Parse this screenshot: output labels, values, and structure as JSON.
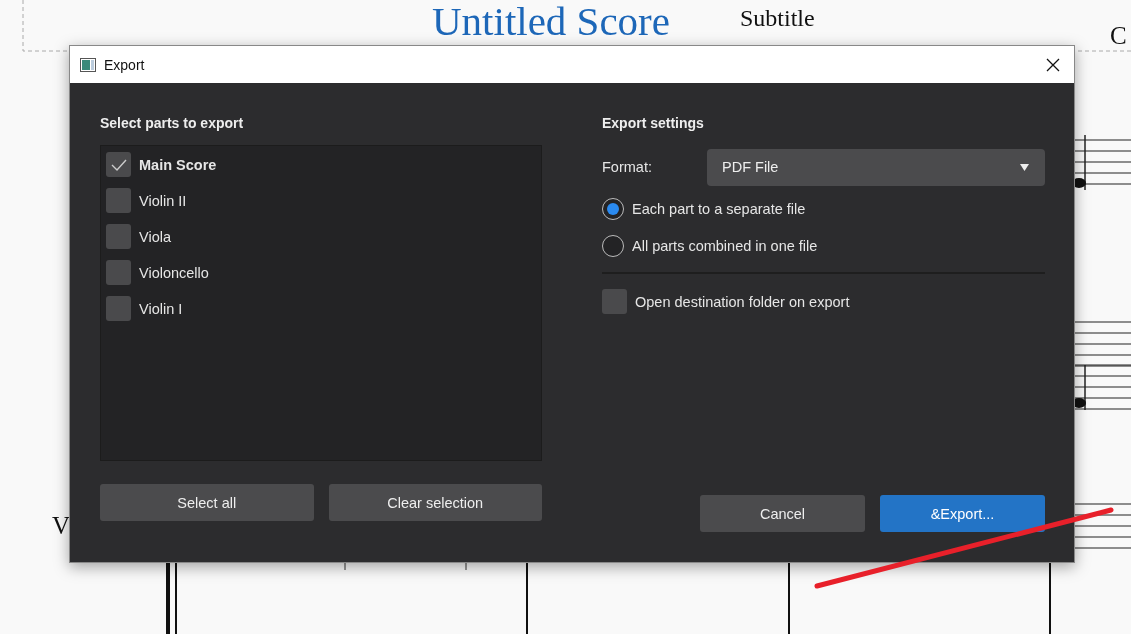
{
  "background_score": {
    "title": "Untitled Score",
    "subtitle": "Subtitle",
    "composer": "C",
    "instrument_labels": [
      "V"
    ]
  },
  "dialog": {
    "title": "Export",
    "parts_heading": "Select parts to export",
    "parts": [
      {
        "label": "Main Score",
        "checked": true
      },
      {
        "label": "Violin II",
        "checked": false
      },
      {
        "label": "Viola",
        "checked": false
      },
      {
        "label": "Violoncello",
        "checked": false
      },
      {
        "label": "Violin I",
        "checked": false
      }
    ],
    "list_buttons": [
      "Select all",
      "Clear selection"
    ],
    "settings_heading": "Export settings",
    "format_label": "Format:",
    "format_value": "PDF File",
    "file_modes": [
      {
        "label": "Each part to a separate file",
        "selected": true
      },
      {
        "label": "All parts combined in one file",
        "selected": false
      }
    ],
    "open_folder": {
      "label": "Open destination folder on export",
      "checked": false
    },
    "buttons": [
      {
        "label": "Cancel",
        "kind": "secondary"
      },
      {
        "label": "&Export...",
        "kind": "primary"
      }
    ]
  }
}
